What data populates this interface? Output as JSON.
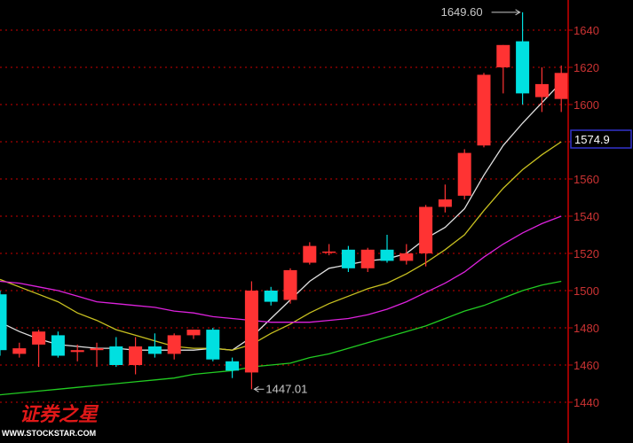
{
  "chart_data": {
    "type": "candlestick",
    "ylim": [
      1430,
      1650
    ],
    "y_ticks": [
      1440,
      1460,
      1480,
      1500,
      1520,
      1540,
      1560,
      1580,
      1600,
      1620,
      1640
    ],
    "grid": true,
    "colors": {
      "up": "#ff3333",
      "down": "#00e0e0",
      "background": "#000000",
      "axis": "#cc0000",
      "grid": "#cc0000"
    },
    "candles": [
      {
        "open": 1498,
        "close": 1468,
        "high": 1500,
        "low": 1465
      },
      {
        "open": 1466,
        "close": 1469,
        "high": 1472,
        "low": 1464
      },
      {
        "open": 1471,
        "close": 1478,
        "high": 1479,
        "low": 1459
      },
      {
        "open": 1476,
        "close": 1465,
        "high": 1478,
        "low": 1464
      },
      {
        "open": 1467,
        "close": 1468,
        "high": 1471,
        "low": 1462
      },
      {
        "open": 1468,
        "close": 1469,
        "high": 1472,
        "low": 1459
      },
      {
        "open": 1470,
        "close": 1460,
        "high": 1475,
        "low": 1459
      },
      {
        "open": 1460,
        "close": 1470,
        "high": 1475,
        "low": 1455
      },
      {
        "open": 1470,
        "close": 1466,
        "high": 1477,
        "low": 1464
      },
      {
        "open": 1466,
        "close": 1476,
        "high": 1477,
        "low": 1463
      },
      {
        "open": 1476,
        "close": 1479,
        "high": 1479,
        "low": 1474
      },
      {
        "open": 1479,
        "close": 1463,
        "high": 1480,
        "low": 1462
      },
      {
        "open": 1462,
        "close": 1457,
        "high": 1464,
        "low": 1453
      },
      {
        "open": 1456,
        "close": 1500,
        "high": 1505,
        "low": 1447.01
      },
      {
        "open": 1500,
        "close": 1494,
        "high": 1502,
        "low": 1492
      },
      {
        "open": 1495,
        "close": 1511,
        "high": 1512,
        "low": 1493
      },
      {
        "open": 1515,
        "close": 1524,
        "high": 1526,
        "low": 1514
      },
      {
        "open": 1521,
        "close": 1521,
        "high": 1525,
        "low": 1519
      },
      {
        "open": 1522,
        "close": 1512,
        "high": 1524,
        "low": 1510
      },
      {
        "open": 1512,
        "close": 1522,
        "high": 1523,
        "low": 1510
      },
      {
        "open": 1522,
        "close": 1516,
        "high": 1530,
        "low": 1515
      },
      {
        "open": 1516,
        "close": 1520,
        "high": 1525,
        "low": 1514
      },
      {
        "open": 1520,
        "close": 1545,
        "high": 1546,
        "low": 1513
      },
      {
        "open": 1545,
        "close": 1549,
        "high": 1557,
        "low": 1542
      },
      {
        "open": 1551,
        "close": 1574,
        "high": 1576,
        "low": 1549
      },
      {
        "open": 1578,
        "close": 1616,
        "high": 1617,
        "low": 1577
      },
      {
        "open": 1620,
        "close": 1632,
        "high": 1632,
        "low": 1606
      },
      {
        "open": 1634,
        "close": 1606,
        "high": 1649.6,
        "low": 1600
      },
      {
        "open": 1604,
        "close": 1611,
        "high": 1620,
        "low": 1596
      },
      {
        "open": 1603,
        "close": 1617,
        "high": 1621,
        "low": 1596
      }
    ],
    "moving_averages": [
      {
        "color": "#e0e0e0",
        "values": [
          1483,
          1478,
          1474,
          1471,
          1470,
          1469,
          1469,
          1468,
          1468,
          1468,
          1468,
          1469,
          1468,
          1475,
          1485,
          1495,
          1505,
          1512,
          1514,
          1516,
          1517,
          1520,
          1528,
          1534,
          1544,
          1562,
          1578,
          1590,
          1601,
          1612
        ]
      },
      {
        "color": "#c8c020",
        "values": [
          1506,
          1502,
          1498,
          1494,
          1488,
          1484,
          1479,
          1476,
          1473,
          1470,
          1469,
          1469,
          1468,
          1471,
          1477,
          1482,
          1488,
          1493,
          1497,
          1501,
          1504,
          1509,
          1515,
          1522,
          1530,
          1543,
          1555,
          1565,
          1573,
          1580
        ]
      },
      {
        "color": "#dd22dd",
        "values": [
          1505,
          1504,
          1502,
          1500,
          1497,
          1494,
          1493,
          1492,
          1491,
          1489,
          1488,
          1486,
          1485,
          1484,
          1483,
          1483,
          1483,
          1484,
          1485,
          1487,
          1490,
          1494,
          1499,
          1504,
          1510,
          1518,
          1525,
          1531,
          1536,
          1540
        ]
      },
      {
        "color": "#22cc22",
        "values": [
          1444,
          1445,
          1446,
          1447,
          1448,
          1449,
          1450,
          1451,
          1452,
          1453,
          1455,
          1456,
          1457,
          1459,
          1460,
          1461,
          1464,
          1466,
          1469,
          1472,
          1475,
          1478,
          1481,
          1485,
          1489,
          1492,
          1496,
          1500,
          1503,
          1505
        ]
      }
    ],
    "annotations": [
      {
        "text": "1649.60",
        "value": 1649.6,
        "candle_index": 27,
        "arrow": "right"
      },
      {
        "text": "1447.01",
        "value": 1447.01,
        "candle_index": 13,
        "arrow": "left"
      }
    ],
    "current_price": "1574.9"
  },
  "watermark": {
    "chinese": "证券之星",
    "english": "WWW.STOCKSTAR.COM"
  }
}
